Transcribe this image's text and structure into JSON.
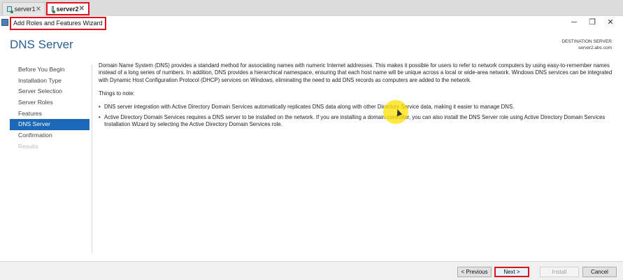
{
  "tabs": [
    {
      "label": "server1",
      "active": false
    },
    {
      "label": "server2",
      "active": true
    }
  ],
  "window": {
    "title": "Add Roles and Features Wizard",
    "minimize": "─",
    "maximize": "❐",
    "close": "✕"
  },
  "page": {
    "title": "DNS Server",
    "destination_label": "DESTINATION SERVER",
    "destination_server": "server2.abc.com"
  },
  "nav": {
    "items": [
      {
        "label": "Before You Begin",
        "state": "normal"
      },
      {
        "label": "Installation Type",
        "state": "normal"
      },
      {
        "label": "Server Selection",
        "state": "normal"
      },
      {
        "label": "Server Roles",
        "state": "normal"
      },
      {
        "label": "Features",
        "state": "normal"
      },
      {
        "label": "DNS Server",
        "state": "active"
      },
      {
        "label": "Confirmation",
        "state": "normal"
      },
      {
        "label": "Results",
        "state": "disabled"
      }
    ]
  },
  "content": {
    "intro": "Domain Name System (DNS) provides a standard method for associating names with numeric Internet addresses. This makes it possible for users to refer to network computers by using easy-to-remember names instead of a long series of numbers. In addition, DNS provides a hierarchical namespace, ensuring that each host name will be unique across a local or wide-area network. Windows DNS services can be integrated with Dynamic Host Configuration Protocol (DHCP) services on Windows, eliminating the need to add DNS records as computers are added to the network.",
    "notes_title": "Things to note:",
    "notes": [
      "DNS server integration with Active Directory Domain Services automatically replicates DNS data along with other Directory Service data, making it easier to manage DNS.",
      "Active Directory Domain Services requires a DNS server to be installed on the network. If you are installing a domain controller, you can also install the DNS Server role using Active Directory Domain Services Installation Wizard by selecting the Active Directory Domain Services role."
    ]
  },
  "buttons": {
    "previous": "< Previous",
    "next": "Next >",
    "install": "Install",
    "cancel": "Cancel"
  },
  "colors": {
    "accent": "#1a68b8",
    "title": "#2a5f92",
    "highlight_box": "#e0121f",
    "cursor_highlight": "#ffe000"
  }
}
